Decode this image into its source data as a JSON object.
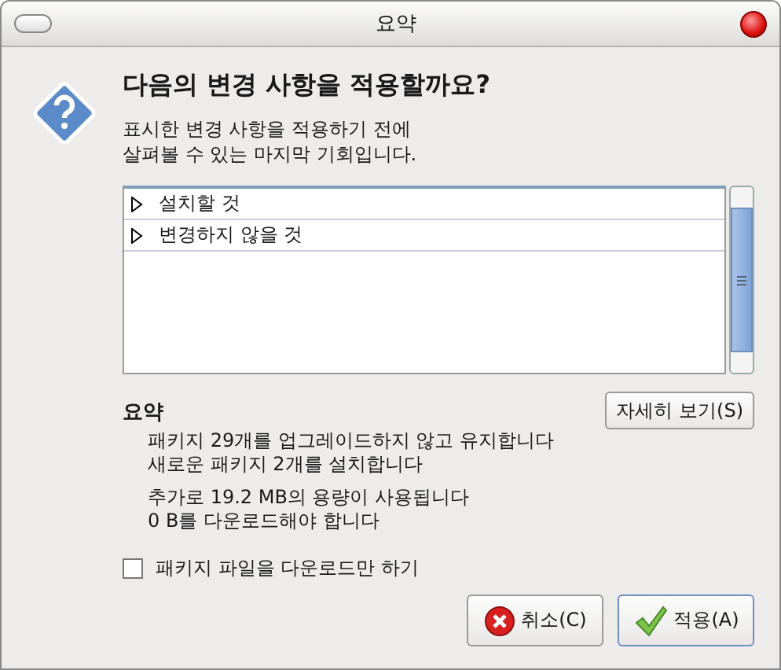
{
  "window": {
    "title": "요약"
  },
  "heading": "다음의 변경 사항을 적용할까요?",
  "description": [
    "표시한 변경 사항을 적용하기 전에",
    "살펴볼 수 있는 마지막 기회입니다."
  ],
  "tree": [
    {
      "label": "설치할 것",
      "expanded": false,
      "selected": false
    },
    {
      "label": "변경하지 않을 것",
      "expanded": false,
      "selected": false
    }
  ],
  "summary": {
    "title": "요약",
    "groups": [
      [
        "패키지 29개를 업그레이드하지 않고 유지합니다",
        "새로운 패키지 2개를 설치합니다"
      ],
      [
        "추가로 19.2 MB의 용량이 사용됩니다",
        "0  B를 다운로드해야 합니다"
      ]
    ],
    "details_button": "자세히 보기(S)"
  },
  "download_only": {
    "label": "패키지 파일을 다운로드만 하기",
    "checked": false
  },
  "buttons": [
    {
      "kind": "cancel",
      "label": "취소(C)"
    },
    {
      "kind": "apply",
      "label": "적용(A)"
    }
  ]
}
